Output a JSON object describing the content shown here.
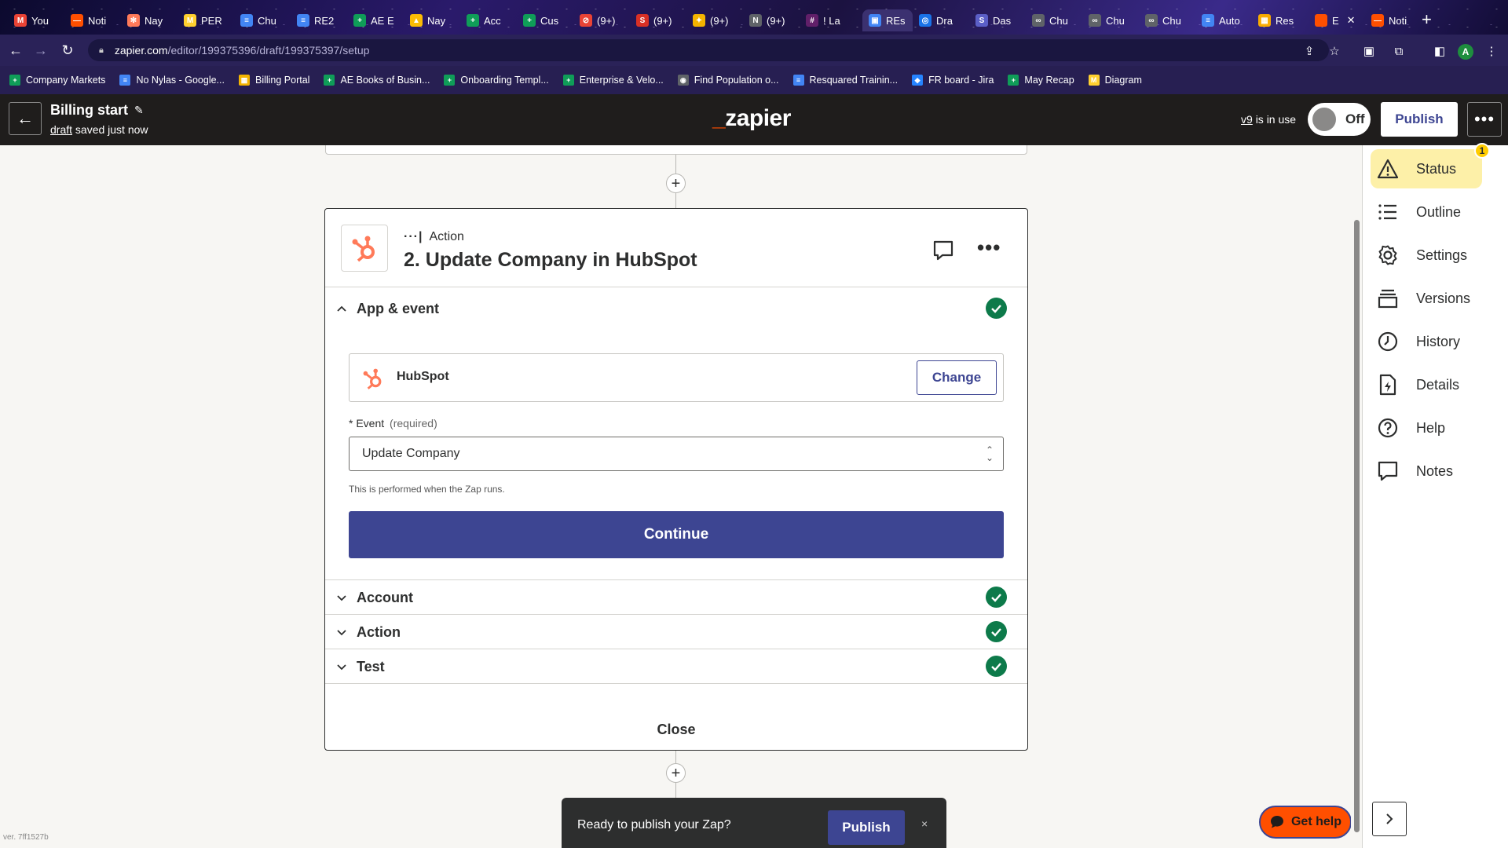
{
  "browser": {
    "tabs": [
      {
        "label": "You",
        "icon": "gmail-icon",
        "color": "#ea4335",
        "glyph": "M"
      },
      {
        "label": "Noti",
        "icon": "zapier-icon",
        "color": "#ff4f00",
        "glyph": "—"
      },
      {
        "label": "Nay",
        "icon": "hubspot-icon",
        "color": "#ff7a59",
        "glyph": "✻"
      },
      {
        "label": "PER",
        "icon": "miro-icon",
        "color": "#ffd02f",
        "glyph": "M"
      },
      {
        "label": "Chu",
        "icon": "docs-icon",
        "color": "#4285f4",
        "glyph": "≡"
      },
      {
        "label": "RE2",
        "icon": "docs-icon",
        "color": "#4285f4",
        "glyph": "≡"
      },
      {
        "label": "AE E",
        "icon": "sheets-icon",
        "color": "#0f9d58",
        "glyph": "+"
      },
      {
        "label": "Nay",
        "icon": "drive-icon",
        "color": "#fbbc04",
        "glyph": "▲"
      },
      {
        "label": "Acc",
        "icon": "sheets-icon",
        "color": "#0f9d58",
        "glyph": "+"
      },
      {
        "label": "Cus",
        "icon": "sheets-icon",
        "color": "#0f9d58",
        "glyph": "+"
      },
      {
        "label": "(9+)",
        "icon": "blocked-icon",
        "color": "#ea4335",
        "glyph": "⊘"
      },
      {
        "label": "(9+)",
        "icon": "sos-icon",
        "color": "#d93025",
        "glyph": "S"
      },
      {
        "label": "(9+)",
        "icon": "sparkle-icon",
        "color": "#f4b400",
        "glyph": "✦"
      },
      {
        "label": "(9+)",
        "icon": "new-icon",
        "color": "#5f6368",
        "glyph": "N"
      },
      {
        "label": "! La",
        "icon": "slack-icon",
        "color": "#611f69",
        "glyph": "#"
      },
      {
        "label": "REs",
        "icon": "calendar-icon",
        "color": "#4285f4",
        "glyph": "▣",
        "active": true
      },
      {
        "label": "Dra",
        "icon": "globe-icon",
        "color": "#1a73e8",
        "glyph": "◎"
      },
      {
        "label": "Das",
        "icon": "s-app-icon",
        "color": "#5b5fc7",
        "glyph": "S"
      },
      {
        "label": "Chu",
        "icon": "link-icon",
        "color": "#5f6368",
        "glyph": "∞"
      },
      {
        "label": "Chu",
        "icon": "link-icon",
        "color": "#5f6368",
        "glyph": "∞"
      },
      {
        "label": "Chu",
        "icon": "link-icon",
        "color": "#5f6368",
        "glyph": "∞"
      },
      {
        "label": "Auto",
        "icon": "docs-icon",
        "color": "#4285f4",
        "glyph": "≡"
      },
      {
        "label": "Res",
        "icon": "grid-app-icon",
        "color": "#f9ab00",
        "glyph": "▦"
      },
      {
        "label": "E",
        "icon": "zapier-square-icon",
        "color": "#ff4f00",
        "glyph": "",
        "current": true
      },
      {
        "label": "Noti",
        "icon": "zapier-icon",
        "color": "#ff4f00",
        "glyph": "—"
      }
    ],
    "url_host": "zapier.com",
    "url_path": "/editor/199375396/draft/199375397/setup",
    "profile_initial": "A",
    "bookmarks": [
      {
        "label": "Company Markets",
        "color": "#0f9d58",
        "glyph": "+"
      },
      {
        "label": "No Nylas - Google...",
        "color": "#4285f4",
        "glyph": "≡"
      },
      {
        "label": "Billing Portal",
        "color": "#f4b400",
        "glyph": "▦"
      },
      {
        "label": "AE Books of Busin...",
        "color": "#0f9d58",
        "glyph": "+"
      },
      {
        "label": "Onboarding Templ...",
        "color": "#0f9d58",
        "glyph": "+"
      },
      {
        "label": "Enterprise & Velo...",
        "color": "#0f9d58",
        "glyph": "+"
      },
      {
        "label": "Find Population o...",
        "color": "#5f6368",
        "glyph": "◉"
      },
      {
        "label": "Resquared Trainin...",
        "color": "#4285f4",
        "glyph": "≡"
      },
      {
        "label": "FR board - Jira",
        "color": "#2684ff",
        "glyph": "◆"
      },
      {
        "label": "May Recap",
        "color": "#0f9d58",
        "glyph": "+"
      },
      {
        "label": "Diagram",
        "color": "#ffd02f",
        "glyph": "M"
      }
    ]
  },
  "header": {
    "zap_name": "Billing start",
    "draft_link": "draft",
    "saved_status": "saved just now",
    "logo_prefix": "_",
    "logo_text": "zapier",
    "version_link": "v9",
    "version_status": "is in use",
    "toggle_label": "Off",
    "publish_label": "Publish"
  },
  "step": {
    "type_label": "Action",
    "title": "2. Update Company in HubSpot",
    "sections": {
      "app_event": "App & event",
      "account": "Account",
      "action": "Action",
      "test": "Test"
    },
    "app_name": "HubSpot",
    "change_label": "Change",
    "event_asterisk": "*",
    "event_label": "Event",
    "event_required": "(required)",
    "event_value": "Update Company",
    "event_help": "This is performed when the Zap runs.",
    "continue_label": "Continue",
    "close_label": "Close"
  },
  "toast": {
    "message": "Ready to publish your Zap?",
    "publish_label": "Publish",
    "close_glyph": "×"
  },
  "version_string": "ver. 7ff1527b",
  "get_help_label": "Get help",
  "sidebar": {
    "status_badge": "1",
    "items": [
      {
        "label": "Status",
        "icon": "warning-icon"
      },
      {
        "label": "Outline",
        "icon": "list-icon"
      },
      {
        "label": "Settings",
        "icon": "gear-icon"
      },
      {
        "label": "Versions",
        "icon": "versions-icon"
      },
      {
        "label": "History",
        "icon": "clock-icon"
      },
      {
        "label": "Details",
        "icon": "file-bolt-icon"
      },
      {
        "label": "Help",
        "icon": "question-icon"
      },
      {
        "label": "Notes",
        "icon": "note-icon"
      }
    ]
  },
  "colors": {
    "brand_orange": "#ff4f00",
    "primary_blue": "#3d4592",
    "success_green": "#0d7a4a",
    "status_highlight": "#fdf0a8"
  }
}
